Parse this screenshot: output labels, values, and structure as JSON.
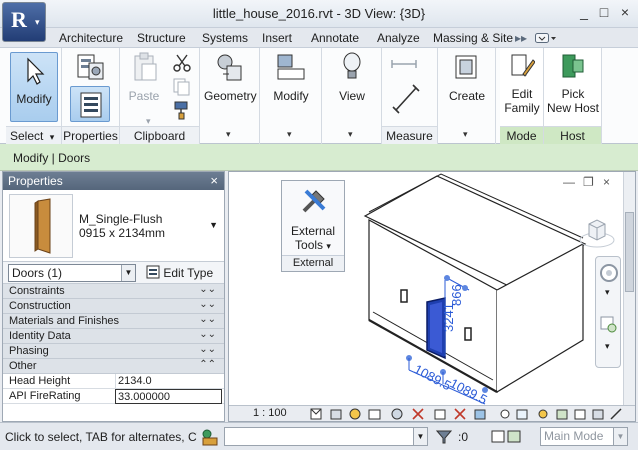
{
  "window": {
    "title": "little_house_2016.rvt - 3D View: {3D}",
    "controls": [
      "_",
      "□",
      "×"
    ]
  },
  "app_button": {
    "glyph": "R",
    "caret": "▾"
  },
  "tabs": [
    "Architecture",
    "Structure",
    "Systems",
    "Insert",
    "Annotate",
    "Analyze",
    "Massing & Site"
  ],
  "tab_overflow": "▸▸",
  "ribbon": {
    "select": {
      "button": "Modify",
      "panel": "Select",
      "dropdown": "▾"
    },
    "properties": {
      "panel": "Properties"
    },
    "clipboard": {
      "paste": "Paste",
      "panel": "Clipboard"
    },
    "geometry": {
      "button": "Geometry",
      "chev": "▾"
    },
    "modify": {
      "button": "Modify",
      "chev": "▾"
    },
    "view": {
      "button": "View",
      "chev": "▾"
    },
    "measure": {
      "panel": "Measure",
      "dropdown": "▾"
    },
    "create": {
      "button": "Create",
      "chev": "▾"
    },
    "mode": {
      "button_line1": "Edit",
      "button_line2": "Family",
      "panel": "Mode"
    },
    "host": {
      "button_line1": "Pick",
      "button_line2": "New Host",
      "panel": "Host"
    }
  },
  "context_bar": "Modify | Doors",
  "properties_palette": {
    "header": "Properties",
    "close": "×",
    "type_name": "M_Single-Flush",
    "type_size": "0915 x 2134mm",
    "type_dropdown": "▼",
    "instance_filter": "Doors (1)",
    "combo_arrow": "▼",
    "edit_type": "Edit Type",
    "groups": [
      {
        "label": "Constraints",
        "toggle": "⌄⌄"
      },
      {
        "label": "Construction",
        "toggle": "⌄⌄"
      },
      {
        "label": "Materials and Finishes",
        "toggle": "⌄⌄"
      },
      {
        "label": "Identity Data",
        "toggle": "⌄⌄"
      },
      {
        "label": "Phasing",
        "toggle": "⌄⌄"
      },
      {
        "label": "Other",
        "toggle": "⌃⌃"
      }
    ],
    "params": [
      {
        "name": "Head Height",
        "value": "2134.0"
      },
      {
        "name": "API FireRating",
        "value": "33.000000"
      }
    ]
  },
  "view": {
    "controls": [
      "—",
      "❐",
      "×"
    ],
    "external_panel": {
      "button_line1": "External",
      "button_line2": "Tools",
      "title": "External",
      "chev": "▾"
    },
    "dimensions": [
      "3241",
      "866",
      "1089.5",
      "1089.5"
    ],
    "scale": "1 : 100",
    "nav_chev": "▾"
  },
  "statusbar": {
    "hint": "Click to select, TAB for alternates, CTRL",
    "count": ":0",
    "mode": "Main Mode",
    "combo_arrow": "▼"
  }
}
